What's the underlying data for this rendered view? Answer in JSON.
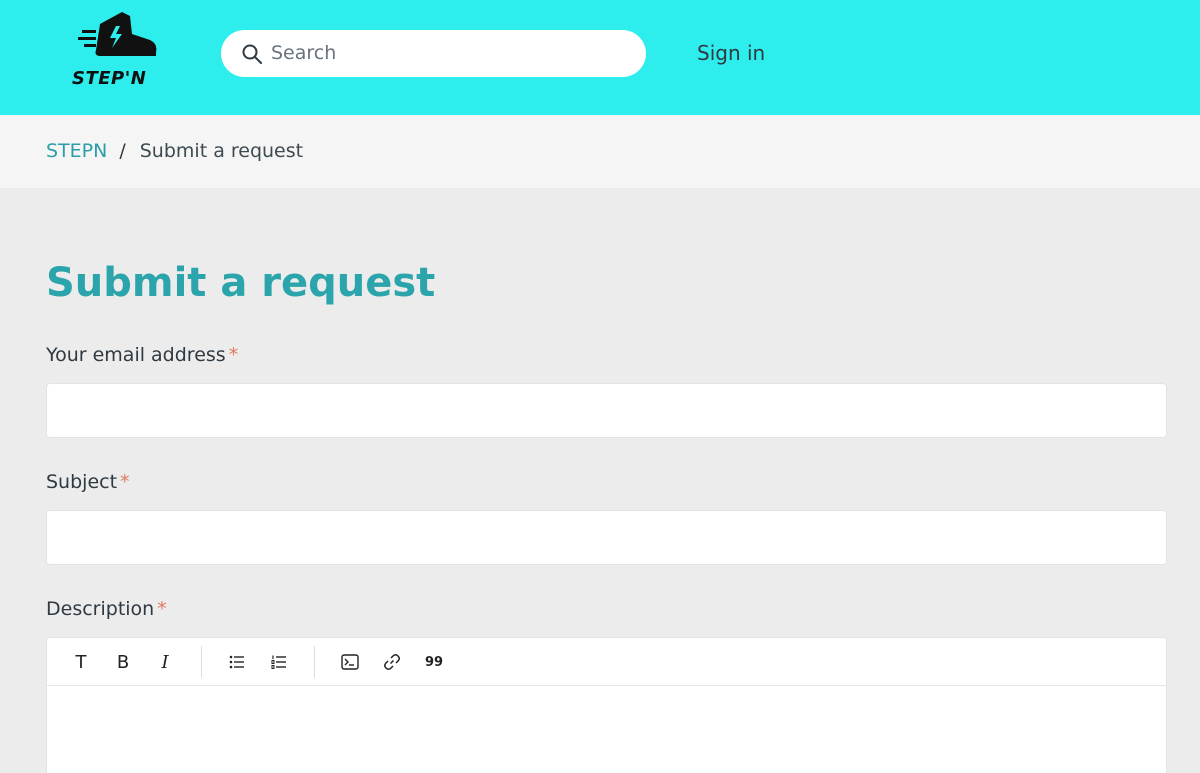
{
  "header": {
    "logo_text": "STEP'N",
    "search_placeholder": "Search",
    "signin_label": "Sign in",
    "bg_color": "#2deeed"
  },
  "breadcrumb": {
    "root": "STEPN",
    "separator": "/",
    "current": "Submit a request"
  },
  "form": {
    "title": "Submit a request",
    "email_label": "Your email address",
    "subject_label": "Subject",
    "description_label": "Description",
    "required_mark": "*",
    "toolbar": {
      "text_label": "T",
      "bold_label": "B",
      "italic_label": "I",
      "quote_label": "99"
    }
  }
}
